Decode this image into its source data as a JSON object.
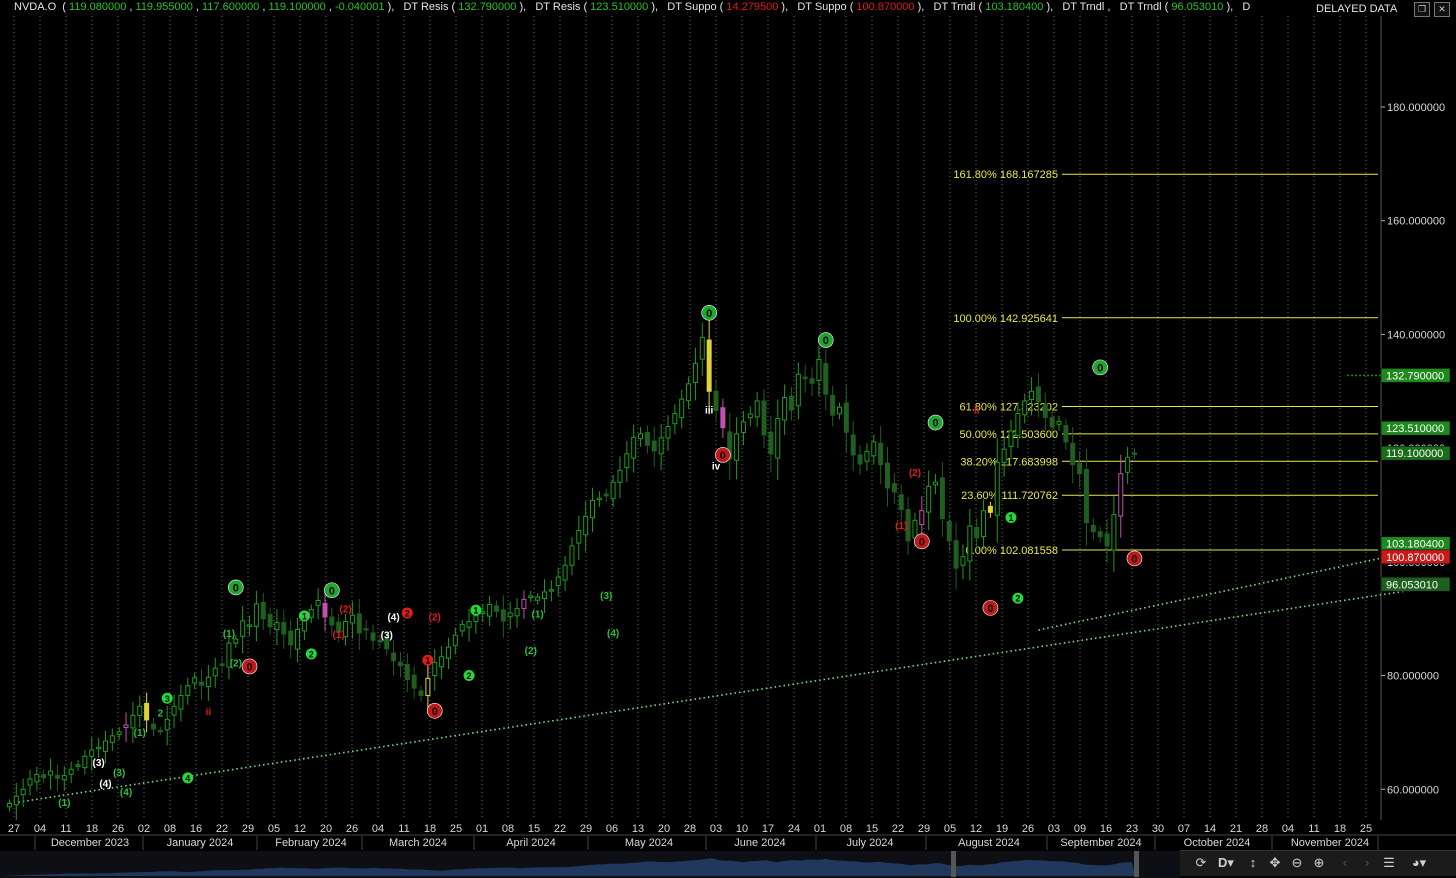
{
  "legend": {
    "symbol": "NVDA.O",
    "ohlc": [
      "119.080000",
      "119.955000",
      "117.600000",
      "119.100000",
      "-0.040001"
    ],
    "studies": [
      {
        "name": "DT Resis",
        "value": "132.790000",
        "color": "green"
      },
      {
        "name": "DT Resis",
        "value": "123.510000",
        "color": "green"
      },
      {
        "name": "DT Suppo",
        "value": "14.279500",
        "color": "red"
      },
      {
        "name": "DT Suppo",
        "value": "100.870000",
        "color": "red"
      },
      {
        "name": "DT Trndl",
        "value": "103.180400",
        "color": "green"
      },
      {
        "name": "DT Trndl",
        "value": "",
        "color": "none"
      },
      {
        "name": "DT Trndl",
        "value": "96.053010",
        "color": "green"
      }
    ],
    "trailing": "D"
  },
  "delayed_label": "DELAYED DATA",
  "colors": {
    "background": "#000000",
    "up_candle": "#1a9e1a",
    "down_candle": "#1f5f1f",
    "fib_line": "#e8e84a",
    "trendline": "#7ee07e",
    "resistance_tag": "#1e8a1e",
    "support_tag": "#c91a1a"
  },
  "chart_data": {
    "type": "candlestick",
    "ylim": [
      56,
      196
    ],
    "y_ticks": [
      "60.000000",
      "80.000000",
      "100.000000",
      "120.000000",
      "140.000000",
      "160.000000",
      "180.000000"
    ],
    "y_tick_values": [
      60,
      80,
      100,
      120,
      140,
      160,
      180
    ],
    "x_ticks": [
      "27",
      "04",
      "11",
      "18",
      "26",
      "02",
      "08",
      "16",
      "22",
      "29",
      "05",
      "12",
      "20",
      "26",
      "04",
      "11",
      "18",
      "25",
      "01",
      "08",
      "15",
      "22",
      "29",
      "06",
      "13",
      "20",
      "28",
      "03",
      "10",
      "17",
      "24",
      "01",
      "08",
      "15",
      "22",
      "29",
      "05",
      "12",
      "19",
      "26",
      "03",
      "09",
      "16",
      "23",
      "30",
      "07",
      "14",
      "21",
      "28",
      "04",
      "11",
      "18",
      "25"
    ],
    "months": [
      "December 2023",
      "January 2024",
      "February 2024",
      "March 2024",
      "April 2024",
      "May 2024",
      "June 2024",
      "July 2024",
      "August 2024",
      "September 2024",
      "October 2024",
      "November 2024"
    ],
    "price_tags": [
      {
        "value": 132.79,
        "label": "132.790000",
        "kind": "resistance"
      },
      {
        "value": 123.51,
        "label": "123.510000",
        "kind": "resistance"
      },
      {
        "value": 119.1,
        "label": "119.100000",
        "kind": "last"
      },
      {
        "value": 103.1804,
        "label": "103.180400",
        "kind": "trend"
      },
      {
        "value": 100.87,
        "label": "100.870000",
        "kind": "support"
      },
      {
        "value": 96.05301,
        "label": "96.053010",
        "kind": "trend2"
      }
    ],
    "fibonacci": [
      {
        "value": 168.167285,
        "label": "161.80% 168.167285"
      },
      {
        "value": 142.925641,
        "label": "100.00% 142.925641"
      },
      {
        "value": 127.323202,
        "label": "61.80% 127.323202"
      },
      {
        "value": 122.5036,
        "label": "50.00% 122.503600"
      },
      {
        "value": 117.683998,
        "label": "38.20% 117.683998"
      },
      {
        "value": 111.720762,
        "label": "23.60% 111.720762"
      },
      {
        "value": 102.081558,
        "label": "0.00% 102.081558"
      }
    ],
    "trendlines": [
      {
        "from": [
          0,
          57.5
        ],
        "to": [
          210,
          96.05
        ]
      },
      {
        "from": [
          150,
          88
        ],
        "to": [
          210,
          103.18
        ]
      }
    ],
    "resistance_segment": {
      "value": 132.79,
      "from": 195,
      "to": 210
    },
    "closes": [
      57.5,
      58.8,
      60.0,
      61.8,
      62.6,
      62.0,
      63.2,
      61.9,
      62.4,
      63.5,
      64.3,
      65.8,
      66.9,
      67.4,
      68.5,
      69.4,
      70.1,
      71.3,
      73.0,
      74.6,
      72.2,
      70.6,
      70.2,
      72.3,
      74.6,
      76.5,
      78.2,
      79.6,
      78.3,
      79.7,
      81.3,
      82.0,
      85.7,
      86.4,
      89.6,
      88.9,
      92.6,
      90.0,
      88.6,
      89.3,
      87.3,
      85.4,
      88.1,
      90.0,
      91.6,
      93.2,
      90.3,
      88.9,
      87.6,
      89.5,
      90.6,
      87.5,
      88.0,
      86.2,
      85.9,
      84.7,
      82.6,
      81.7,
      79.3,
      77.8,
      76.5,
      79.5,
      82.3,
      83.3,
      85.0,
      87.1,
      89.0,
      89.5,
      90.5,
      91.2,
      92.5,
      91.3,
      89.6,
      91.0,
      91.8,
      93.4,
      94.0,
      93.8,
      94.7,
      95.1,
      97.3,
      99.4,
      102.8,
      105.5,
      108.0,
      110.8,
      111.2,
      111.6,
      114.0,
      116.1,
      119.0,
      121.9,
      122.5,
      120.5,
      119.5,
      121.8,
      123.8,
      126.1,
      128.6,
      131.3,
      134.9,
      139.5,
      130.0,
      126.6,
      123.6,
      118.1,
      122.5,
      124.6,
      126.0,
      128.3,
      122.3,
      119.0,
      125.2,
      128.9,
      126.7,
      133.0,
      132.2,
      131.4,
      135.6,
      129.5,
      125.8,
      127.2,
      122.8,
      118.8,
      117.2,
      119.4,
      121.1,
      117.1,
      113.0,
      112.3,
      109.2,
      103.7,
      107.3,
      109.0,
      113.3,
      114.0,
      107.6,
      103.7,
      98.9,
      100.9,
      106.3,
      104.2,
      109.0,
      108.7,
      117.5,
      119.8,
      123.0,
      126.1,
      128.3,
      130.0,
      128.2,
      125.4,
      123.7,
      124.7,
      121.1,
      117.1,
      115.5,
      106.9,
      105.3,
      104.4,
      102.8,
      108.3,
      115.5,
      118.4,
      119.1
    ],
    "wave_labels": [
      {
        "i": 33,
        "v": 95.5,
        "t": "0",
        "k": "gc"
      },
      {
        "i": 47,
        "v": 95.0,
        "t": "0",
        "k": "gc"
      },
      {
        "i": 35,
        "v": 81.6,
        "t": "0",
        "k": "rc"
      },
      {
        "i": 62,
        "v": 73.8,
        "t": "0",
        "k": "rc"
      },
      {
        "i": 102,
        "v": 143.8,
        "t": "0",
        "k": "gc"
      },
      {
        "i": 104,
        "v": 118.8,
        "t": "0",
        "k": "rc"
      },
      {
        "i": 119,
        "v": 139.0,
        "t": "0",
        "k": "gc"
      },
      {
        "i": 135,
        "v": 124.5,
        "t": "0",
        "k": "gc"
      },
      {
        "i": 133,
        "v": 103.6,
        "t": "0",
        "k": "rc"
      },
      {
        "i": 143,
        "v": 91.9,
        "t": "0",
        "k": "rc"
      },
      {
        "i": 159,
        "v": 134.2,
        "t": "0",
        "k": "gc"
      },
      {
        "i": 164,
        "v": 100.6,
        "t": "0",
        "k": "rc"
      },
      {
        "i": 23,
        "v": 76.0,
        "t": "3",
        "k": "gs"
      },
      {
        "i": 26,
        "v": 62.0,
        "t": "4",
        "k": "gs"
      },
      {
        "i": 43,
        "v": 90.5,
        "t": "1",
        "k": "gs"
      },
      {
        "i": 44,
        "v": 83.8,
        "t": "2",
        "k": "gs"
      },
      {
        "i": 61,
        "v": 82.7,
        "t": "1",
        "k": "rs"
      },
      {
        "i": 58,
        "v": 91.0,
        "t": "2",
        "k": "rs"
      },
      {
        "i": 67,
        "v": 80.0,
        "t": "2",
        "k": "gs"
      },
      {
        "i": 68,
        "v": 91.5,
        "t": "1",
        "k": "gs"
      },
      {
        "i": 146,
        "v": 107.8,
        "t": "1",
        "k": "gs"
      },
      {
        "i": 147,
        "v": 93.6,
        "t": "2",
        "k": "gs"
      },
      {
        "i": 13,
        "v": 64.8,
        "t": "(3)",
        "k": "w"
      },
      {
        "i": 14,
        "v": 61.1,
        "t": "(4)",
        "k": "w"
      },
      {
        "i": 55,
        "v": 87.2,
        "t": "(3)",
        "k": "w"
      },
      {
        "i": 56,
        "v": 90.4,
        "t": "(4)",
        "k": "w"
      },
      {
        "i": 102,
        "v": 126.8,
        "t": "iii",
        "k": "w"
      },
      {
        "i": 103,
        "v": 116.9,
        "t": "iv",
        "k": "w"
      },
      {
        "i": 49,
        "v": 91.8,
        "t": "(2)",
        "k": "r"
      },
      {
        "i": 48,
        "v": 87.3,
        "t": "(1)",
        "k": "r"
      },
      {
        "i": 62,
        "v": 90.4,
        "t": "(2)",
        "k": "r"
      },
      {
        "i": 132,
        "v": 115.8,
        "t": "(2)",
        "k": "r"
      },
      {
        "i": 130,
        "v": 106.5,
        "t": "(1)",
        "k": "r"
      },
      {
        "i": 29,
        "v": 73.8,
        "t": "ii",
        "k": "r"
      },
      {
        "i": 141,
        "v": 126.8,
        "t": "ii",
        "k": "r"
      },
      {
        "i": 8,
        "v": 57.8,
        "t": "(1)",
        "k": "g"
      },
      {
        "i": 16,
        "v": 63.0,
        "t": "(3)",
        "k": "g"
      },
      {
        "i": 17,
        "v": 59.6,
        "t": "(4)",
        "k": "g"
      },
      {
        "i": 19,
        "v": 70.1,
        "t": "(1)",
        "k": "g"
      },
      {
        "i": 22,
        "v": 73.5,
        "t": "2",
        "k": "g"
      },
      {
        "i": 32,
        "v": 87.5,
        "t": "(1)",
        "k": "g"
      },
      {
        "i": 33,
        "v": 82.3,
        "t": "(2)",
        "k": "g"
      },
      {
        "i": 77,
        "v": 90.9,
        "t": "(1)",
        "k": "g"
      },
      {
        "i": 76,
        "v": 84.5,
        "t": "(2)",
        "k": "g"
      },
      {
        "i": 87,
        "v": 94.2,
        "t": "(3)",
        "k": "g"
      },
      {
        "i": 88,
        "v": 87.6,
        "t": "(4)",
        "k": "g"
      }
    ]
  },
  "toolbar": {
    "period": "D",
    "icons": [
      "refresh-icon",
      "period-dropdown",
      "vertical-fit-icon",
      "pan-icon",
      "zoom-out-icon",
      "zoom-in-icon",
      "scroll-left-icon",
      "scroll-right-icon",
      "menu-icon",
      "palette-icon"
    ]
  }
}
